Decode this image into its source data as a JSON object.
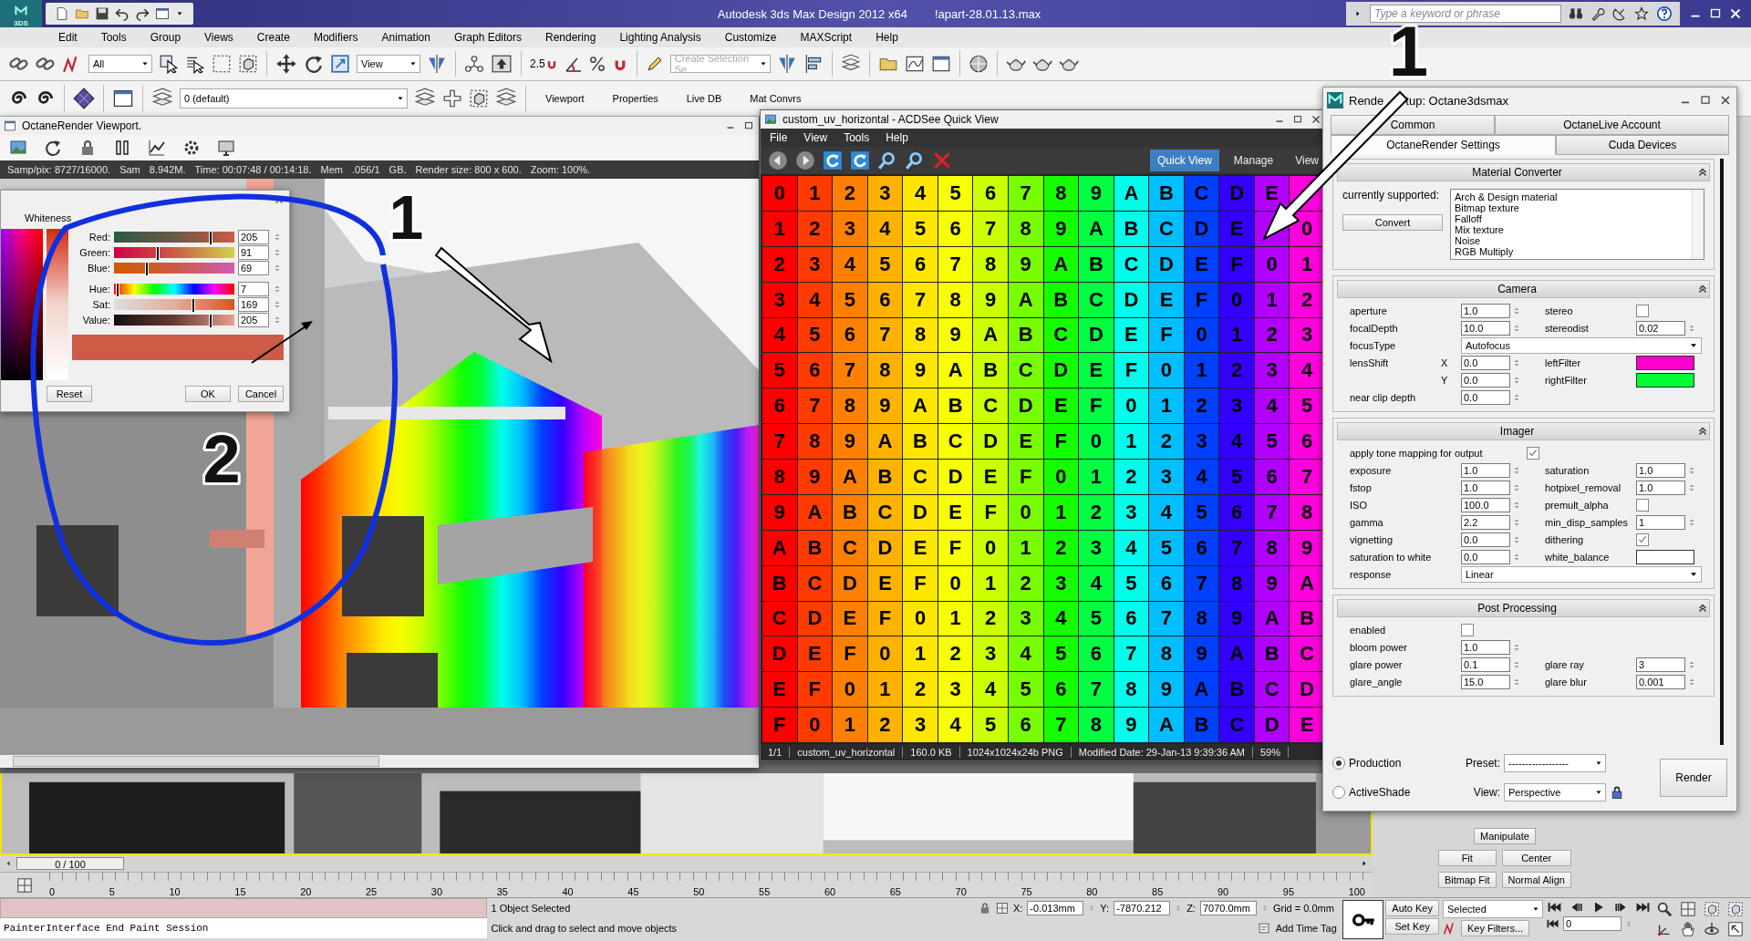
{
  "window": {
    "logo": "3DS",
    "title": "Autodesk 3ds Max Design 2012 x64",
    "file": "!apart-28.01.13.max"
  },
  "search": {
    "placeholder": "Type a keyword or phrase"
  },
  "menu": [
    "Edit",
    "Tools",
    "Group",
    "Views",
    "Create",
    "Modifiers",
    "Animation",
    "Graph Editors",
    "Rendering",
    "Lighting Analysis",
    "Customize",
    "MAXScript",
    "Help"
  ],
  "main_toolbar": {
    "selection_filter": "All",
    "reference_coordinate": "View",
    "snap_label": "2.5",
    "named_selection": {
      "placeholder": "Create Selection Se"
    }
  },
  "layer_toolbar": {
    "layer": "0 (default)",
    "panels": [
      "Viewport",
      "Properties",
      "Live DB",
      "Mat Convrs"
    ]
  },
  "octane_viewport": {
    "title": "OctaneRender Viewport.",
    "status": [
      "Samp/pix: 8727/16000.",
      "Sam",
      "8.942M.",
      "Time: 00:07:48 / 00:14:18.",
      "Mem",
      ".056/1",
      "GB.",
      "Render size: 800 x 600.",
      "Zoom: 100%."
    ]
  },
  "color_dialog": {
    "heading": "Whiteness",
    "channels": [
      {
        "label": "Red:",
        "value": "205",
        "level": 0.8
      },
      {
        "label": "Green:",
        "value": "91",
        "level": 0.36
      },
      {
        "label": "Blue:",
        "value": "69",
        "level": 0.27
      },
      {
        "label": "Hue:",
        "value": "7",
        "level": 0.03
      },
      {
        "label": "Sat:",
        "value": "169",
        "level": 0.66
      },
      {
        "label": "Value:",
        "value": "205",
        "level": 0.8
      }
    ],
    "buttons": [
      "Reset",
      "OK",
      "Cancel"
    ]
  },
  "acdsee": {
    "title": "custom_uv_horizontal - ACDSee Quick View",
    "menu": [
      "File",
      "View",
      "Tools",
      "Help"
    ],
    "modes": [
      {
        "label": "Quick View",
        "selected": true
      },
      {
        "label": "Manage",
        "selected": false
      },
      {
        "label": "View",
        "selected": false
      }
    ],
    "grid": [
      [
        "0",
        "1",
        "2",
        "3",
        "4",
        "5",
        "6",
        "7",
        "8",
        "9",
        "A",
        "B",
        "C",
        "D",
        "E",
        {
          "kind": "covered"
        }
      ],
      [
        "1",
        "2",
        "3",
        "4",
        "5",
        "6",
        "7",
        "8",
        "9",
        "A",
        "B",
        "C",
        "D",
        "E",
        {
          "kind": "covered"
        },
        "0"
      ],
      [
        "2",
        "3",
        "4",
        "5",
        "6",
        "7",
        "8",
        "9",
        "A",
        "B",
        "C",
        "D",
        "E",
        "F",
        "0",
        "1"
      ],
      [
        "3",
        "4",
        "5",
        "6",
        "7",
        "8",
        "9",
        "A",
        "B",
        "C",
        "D",
        "E",
        "F",
        "0",
        "1",
        "2"
      ],
      [
        "4",
        "5",
        "6",
        "7",
        "8",
        "9",
        "A",
        "B",
        "C",
        "D",
        "E",
        "F",
        "0",
        "1",
        "2",
        "3"
      ],
      [
        "5",
        "6",
        "7",
        "8",
        "9",
        "A",
        "B",
        "C",
        "D",
        "E",
        "F",
        "0",
        "1",
        "2",
        "3",
        "4"
      ],
      [
        "6",
        "7",
        "8",
        "9",
        "A",
        "B",
        "C",
        "D",
        "E",
        "F",
        "0",
        "1",
        "2",
        "3",
        "4",
        "5"
      ],
      [
        "7",
        "8",
        "9",
        "A",
        "B",
        "C",
        "D",
        "E",
        "F",
        "0",
        "1",
        "2",
        "3",
        "4",
        "5",
        "6"
      ],
      [
        "8",
        "9",
        "A",
        "B",
        "C",
        "D",
        "E",
        "F",
        "0",
        "1",
        "2",
        "3",
        "4",
        "5",
        "6",
        "7"
      ],
      [
        "9",
        "A",
        "B",
        "C",
        "D",
        "E",
        "F",
        "0",
        "1",
        "2",
        "3",
        "4",
        "5",
        "6",
        "7",
        "8"
      ],
      [
        "A",
        "B",
        "C",
        "D",
        "E",
        "F",
        "0",
        "1",
        "2",
        "3",
        "4",
        "5",
        "6",
        "7",
        "8",
        "9"
      ],
      [
        "B",
        "C",
        "D",
        "E",
        "F",
        "0",
        "1",
        "2",
        "3",
        "4",
        "5",
        "6",
        "7",
        "8",
        "9",
        "A"
      ],
      [
        "C",
        "D",
        "E",
        "F",
        "0",
        "1",
        "2",
        "3",
        "4",
        "5",
        "6",
        "7",
        "8",
        "9",
        "A",
        "B"
      ],
      [
        "D",
        "E",
        "F",
        "0",
        "1",
        "2",
        "3",
        "4",
        "5",
        "6",
        "7",
        "8",
        "9",
        "A",
        "B",
        "C"
      ],
      [
        "E",
        "F",
        "0",
        "1",
        "2",
        "3",
        "4",
        "5",
        "6",
        "7",
        "8",
        "9",
        "A",
        "B",
        "C",
        "D"
      ],
      [
        "F",
        "0",
        "1",
        "2",
        "3",
        "4",
        "5",
        "6",
        "7",
        "8",
        "9",
        "A",
        "B",
        "C",
        "D",
        "E"
      ]
    ],
    "status": [
      "1/1",
      "custom_uv_horizontal",
      "160.0 KB",
      "1024x1024x24b PNG",
      "Modified Date: 29-Jan-13 9:39:36 AM",
      "59%"
    ]
  },
  "render_setup": {
    "title": [
      "Rende",
      "tup: Octane3dsmax"
    ],
    "tabs": [
      {
        "label": "Common",
        "selected": false
      },
      {
        "label": "OctaneLive Account",
        "selected": false
      },
      {
        "label": "OctaneRender Settings",
        "selected": true
      },
      {
        "label": "Cuda Devices",
        "selected": false
      }
    ],
    "rollouts": [
      {
        "kind": "converter",
        "title": "Material Converter",
        "label": "currently supported:",
        "button": "Convert",
        "items": [
          "Arch & Design material",
          "Bitmap texture",
          "Falloff",
          "Mix texture",
          "Noise",
          "RGB Multiply"
        ]
      },
      {
        "kind": "fields",
        "title": "Camera",
        "rows": [
          [
            {
              "label": "aperture",
              "kind": "spinner",
              "value": "1.0"
            },
            {
              "label": "stereo",
              "kind": "checkbox",
              "checked": false
            }
          ],
          [
            {
              "label": "focalDepth",
              "kind": "spinner",
              "value": "10.0"
            },
            {
              "label": "stereodist",
              "kind": "spinner",
              "value": "0.02"
            }
          ],
          [
            {
              "label": "focusType",
              "kind": "dropdown",
              "value": "Autofocus"
            }
          ],
          [
            {
              "label": "lensShift",
              "axis": "X",
              "kind": "spinner",
              "value": "0.0"
            },
            {
              "label": "leftFilter",
              "kind": "swatch",
              "color": "#ff00cc"
            }
          ],
          [
            {
              "axis": "Y",
              "kind": "spinner",
              "value": "0.0"
            },
            {
              "label": "rightFilter",
              "kind": "swatch",
              "color": "#00ff33"
            }
          ],
          [
            {
              "label": "near clip depth",
              "kind": "spinner",
              "value": "0.0"
            }
          ]
        ]
      },
      {
        "kind": "fields",
        "title": "Imager",
        "rows": [
          [
            {
              "label": "apply tone mapping for output",
              "kind": "checkbox",
              "checked": true
            }
          ],
          [
            {
              "label": "exposure",
              "kind": "spinner",
              "value": "1.0"
            },
            {
              "label": "saturation",
              "kind": "spinner",
              "value": "1.0"
            }
          ],
          [
            {
              "label": "fstop",
              "kind": "spinner",
              "value": "1.0"
            },
            {
              "label": "hotpixel_removal",
              "kind": "spinner",
              "value": "1.0"
            }
          ],
          [
            {
              "label": "ISO",
              "kind": "spinner",
              "value": "100.0"
            },
            {
              "label": "premult_alpha",
              "kind": "checkbox",
              "checked": false
            }
          ],
          [
            {
              "label": "gamma",
              "kind": "spinner",
              "value": "2.2"
            },
            {
              "label": "min_disp_samples",
              "kind": "spinner",
              "value": "1"
            }
          ],
          [
            {
              "label": "vignetting",
              "kind": "spinner",
              "value": "0.0"
            },
            {
              "label": "dithering",
              "kind": "checkbox",
              "checked": true
            }
          ],
          [
            {
              "label": "saturation to white",
              "kind": "spinner",
              "value": "0.0"
            },
            {
              "label": "white_balance",
              "kind": "swatch",
              "color": "#ffffff"
            }
          ],
          [
            {
              "label": "response",
              "kind": "dropdown",
              "value": "Linear"
            }
          ]
        ]
      },
      {
        "kind": "fields",
        "title": "Post Processing",
        "rows": [
          [
            {
              "label": "enabled",
              "kind": "checkbox",
              "checked": false
            }
          ],
          [
            {
              "label": "bloom power",
              "kind": "spinner",
              "value": "1.0"
            }
          ],
          [
            {
              "label": "glare power",
              "kind": "spinner",
              "value": "0.1"
            },
            {
              "label": "glare ray",
              "kind": "spinner",
              "value": "3"
            }
          ],
          [
            {
              "label": "glare_angle",
              "kind": "spinner",
              "value": "15.0"
            },
            {
              "label": "glare blur",
              "kind": "spinner",
              "value": "0.001"
            }
          ]
        ]
      }
    ],
    "modes": [
      {
        "label": "Production",
        "selected": true
      },
      {
        "label": "ActiveShade",
        "selected": false
      }
    ],
    "preset": {
      "label": "Preset:",
      "value": "------------------"
    },
    "view": {
      "label": "View:",
      "value": "Perspective"
    },
    "render": "Render"
  },
  "command_panel": {
    "buttons": [
      "Manipulate",
      "Fit",
      "Center",
      "Bitmap Fit",
      "Normal Align"
    ]
  },
  "time_slider": {
    "label": "0 / 100",
    "level": 0
  },
  "track_bar": {
    "ticks": [
      "0",
      "5",
      "10",
      "15",
      "20",
      "25",
      "30",
      "35",
      "40",
      "45",
      "50",
      "55",
      "60",
      "65",
      "70",
      "75",
      "80",
      "85",
      "90",
      "95",
      "100"
    ]
  },
  "status_bar": {
    "script_output": "PainterInterface End Paint Session",
    "selection": "1 Object Selected",
    "prompt": "Click and drag to select and move objects",
    "coords": [
      {
        "label": "X:",
        "value": "-0.013mm"
      },
      {
        "label": "Y:",
        "value": "-7870.212"
      },
      {
        "label": "Z:",
        "value": "7070.0mm"
      }
    ],
    "grid": "Grid = 0.0mm",
    "time_tag": "Add Time Tag",
    "auto_key": "Auto Key",
    "key_mode": "Selected",
    "set_key": "Set Key",
    "key_filters": "Key Filters...",
    "frame": "0"
  },
  "annotations": [
    {
      "kind": "number",
      "text": "1"
    },
    {
      "kind": "number",
      "text": "1"
    },
    {
      "kind": "number",
      "text": "2"
    }
  ]
}
